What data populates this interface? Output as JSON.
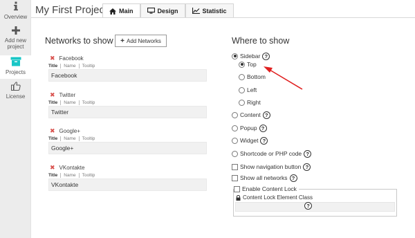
{
  "sidebar": {
    "items": [
      {
        "label": "Overview",
        "icon": "info-icon"
      },
      {
        "label": "Add new project",
        "icon": "plus-icon"
      },
      {
        "label": "Projects",
        "icon": "archive-icon",
        "active": true
      },
      {
        "label": "License",
        "icon": "thumbs-up-icon"
      }
    ]
  },
  "header": {
    "title": "My First Project",
    "tabs": [
      {
        "label": "Main",
        "icon": "home-icon",
        "active": true
      },
      {
        "label": "Design",
        "icon": "monitor-icon"
      },
      {
        "label": "Statistic",
        "icon": "chart-icon"
      }
    ]
  },
  "networks": {
    "title": "Networks to show",
    "add_button": "Add Networks",
    "subtabs": [
      "Title",
      "Name",
      "Tooltip"
    ],
    "items": [
      {
        "name": "Facebook",
        "value": "Facebook"
      },
      {
        "name": "Twitter",
        "value": "Twitter"
      },
      {
        "name": "Google+",
        "value": "Google+"
      },
      {
        "name": "VKontakte",
        "value": "VKontakte"
      }
    ]
  },
  "where": {
    "title": "Where to show",
    "sidebar": "Sidebar",
    "sidebar_options": [
      "Top",
      "Bottom",
      "Left",
      "Right"
    ],
    "selected_sidebar_option": "Top",
    "content": "Content",
    "popup": "Popup",
    "widget": "Widget",
    "shortcode": "Shortcode or PHP code",
    "show_navigation": "Show navigation button",
    "show_all": "Show all networks",
    "enable_lock": "Enable Content Lock",
    "lock_class_label": "Content Lock Element Class",
    "help_glyph": "?"
  },
  "colors": {
    "accent": "#19c6c6",
    "remove": "#d9534f",
    "annotation_arrow": "#e02020"
  }
}
